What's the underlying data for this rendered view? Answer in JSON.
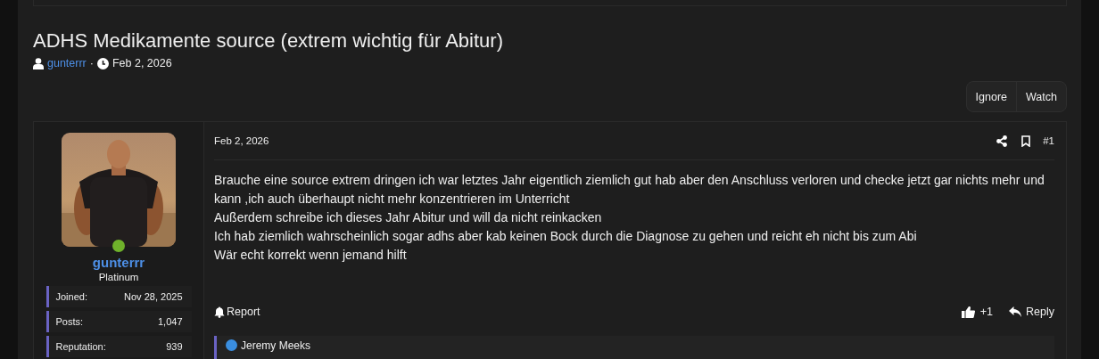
{
  "thread": {
    "title": "ADHS Medikamente source (extrem wichtig für Abitur)",
    "author": "gunterrr",
    "separator": "·",
    "date": "Feb 2, 2026"
  },
  "thread_actions": [
    "Ignore",
    "Watch"
  ],
  "post": {
    "user": {
      "name": "gunterrr",
      "online": true,
      "rank": "Platinum",
      "stats": [
        {
          "label": "Joined:",
          "value": "Nov 28, 2025"
        },
        {
          "label": "Posts:",
          "value": "1,047"
        },
        {
          "label": "Reputation:",
          "value": "939"
        }
      ]
    },
    "date": "Feb 2, 2026",
    "number": "#1",
    "body": [
      "Brauche eine source extrem dringen ich war letztes Jahr eigentlich ziemlich gut hab aber den Anschluss verloren und checke jetzt gar nichts mehr und kann ,ich auch überhaupt nicht mehr konzentrieren im Unterricht",
      "Außerdem schreibe ich dieses Jahr Abitur und will da nicht reinkacken",
      "Ich hab ziemlich wahrscheinlich sogar adhs aber kab keinen Bock durch die Diagnose zu gehen und reicht eh nicht bis zum Abi",
      "Wär echt korrekt wenn jemand hilft"
    ],
    "report": "Report",
    "like_count": "+1",
    "reply": "Reply",
    "reactions": {
      "users": "Jeremy Meeks"
    }
  }
}
